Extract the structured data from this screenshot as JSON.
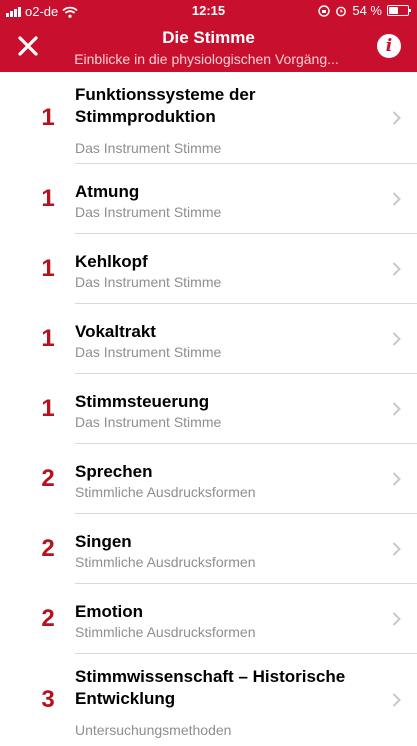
{
  "status_bar": {
    "carrier": "o2-de",
    "time": "12:15",
    "battery": "54 %",
    "battery_level": 0.54
  },
  "nav": {
    "title": "Die Stimme",
    "subtitle": "Einblicke in die physiologischen Vorgäng..."
  },
  "items": [
    {
      "number": "1",
      "title": "Funktionssysteme der Stimmproduktion",
      "subtitle": "Das Instrument Stimme"
    },
    {
      "number": "1",
      "title": "Atmung",
      "subtitle": "Das Instrument Stimme"
    },
    {
      "number": "1",
      "title": "Kehlkopf",
      "subtitle": "Das Instrument Stimme"
    },
    {
      "number": "1",
      "title": "Vokaltrakt",
      "subtitle": "Das Instrument Stimme"
    },
    {
      "number": "1",
      "title": "Stimmsteuerung",
      "subtitle": "Das Instrument Stimme"
    },
    {
      "number": "2",
      "title": "Sprechen",
      "subtitle": "Stimmliche Ausdrucksformen"
    },
    {
      "number": "2",
      "title": "Singen",
      "subtitle": "Stimmliche Ausdrucksformen"
    },
    {
      "number": "2",
      "title": "Emotion",
      "subtitle": "Stimmliche Ausdrucksformen"
    },
    {
      "number": "3",
      "title": "Stimmwissenschaft – Historische Entwicklung",
      "subtitle": "Untersuchungsmethoden"
    }
  ],
  "colors": {
    "accent": "#c8102e",
    "number": "#b5121b",
    "subtitle": "#8e8e93"
  }
}
